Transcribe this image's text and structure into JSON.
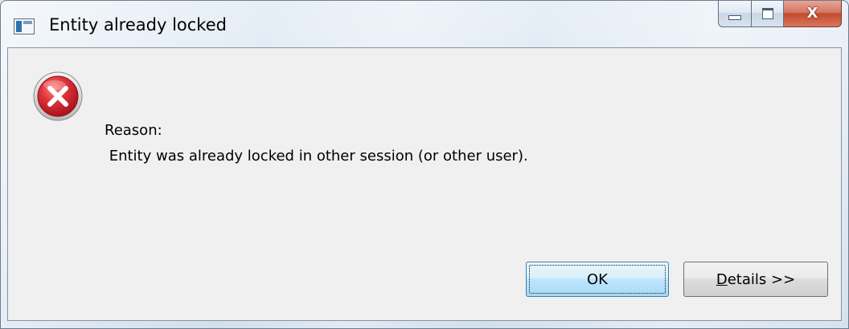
{
  "window": {
    "title": "Entity already locked",
    "caption_buttons": {
      "minimize_icon": "minimize-icon",
      "maximize_icon": "maximize-icon",
      "close_icon": "close-icon",
      "close_glyph": "X"
    }
  },
  "dialog": {
    "icon": "error-icon",
    "reason_label": "Reason:",
    "reason_text": " Entity was already locked in other session (or other user).",
    "buttons": {
      "ok_label": "OK",
      "details_mnemonic": "D",
      "details_rest": "etails >>"
    }
  },
  "colors": {
    "error_red": "#c8202a",
    "close_button": "#c24a30",
    "dialog_background": "#f0f0f0",
    "ok_button_highlight": "#bee6fd"
  }
}
